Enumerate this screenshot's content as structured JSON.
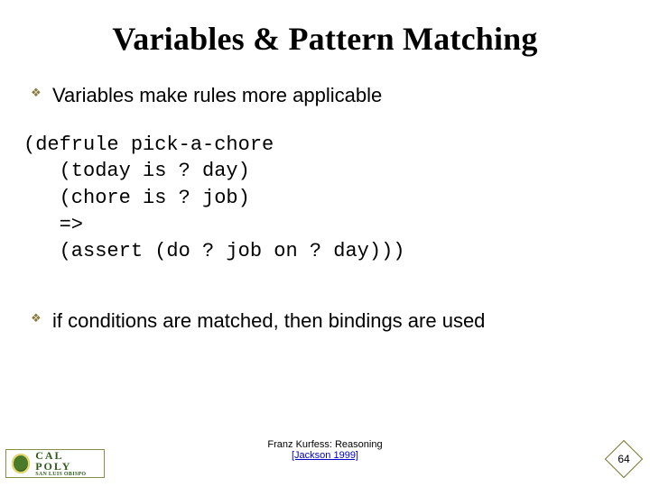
{
  "title": "Variables & Pattern Matching",
  "bullets": {
    "b1": "Variables make rules more applicable",
    "b2": "if conditions are matched, then bindings are used"
  },
  "bullet_glyph": "❖",
  "code": "(defrule pick-a-chore\n   (today is ? day)\n   (chore is ? job)\n   =>\n   (assert (do ? job on ? day)))",
  "credit": {
    "author": "Franz Kurfess: Reasoning",
    "cite_label": "[Jackson 1999]"
  },
  "logo": {
    "line1": "CAL POLY",
    "line2": "SAN LUIS OBISPO"
  },
  "page_number": "64"
}
